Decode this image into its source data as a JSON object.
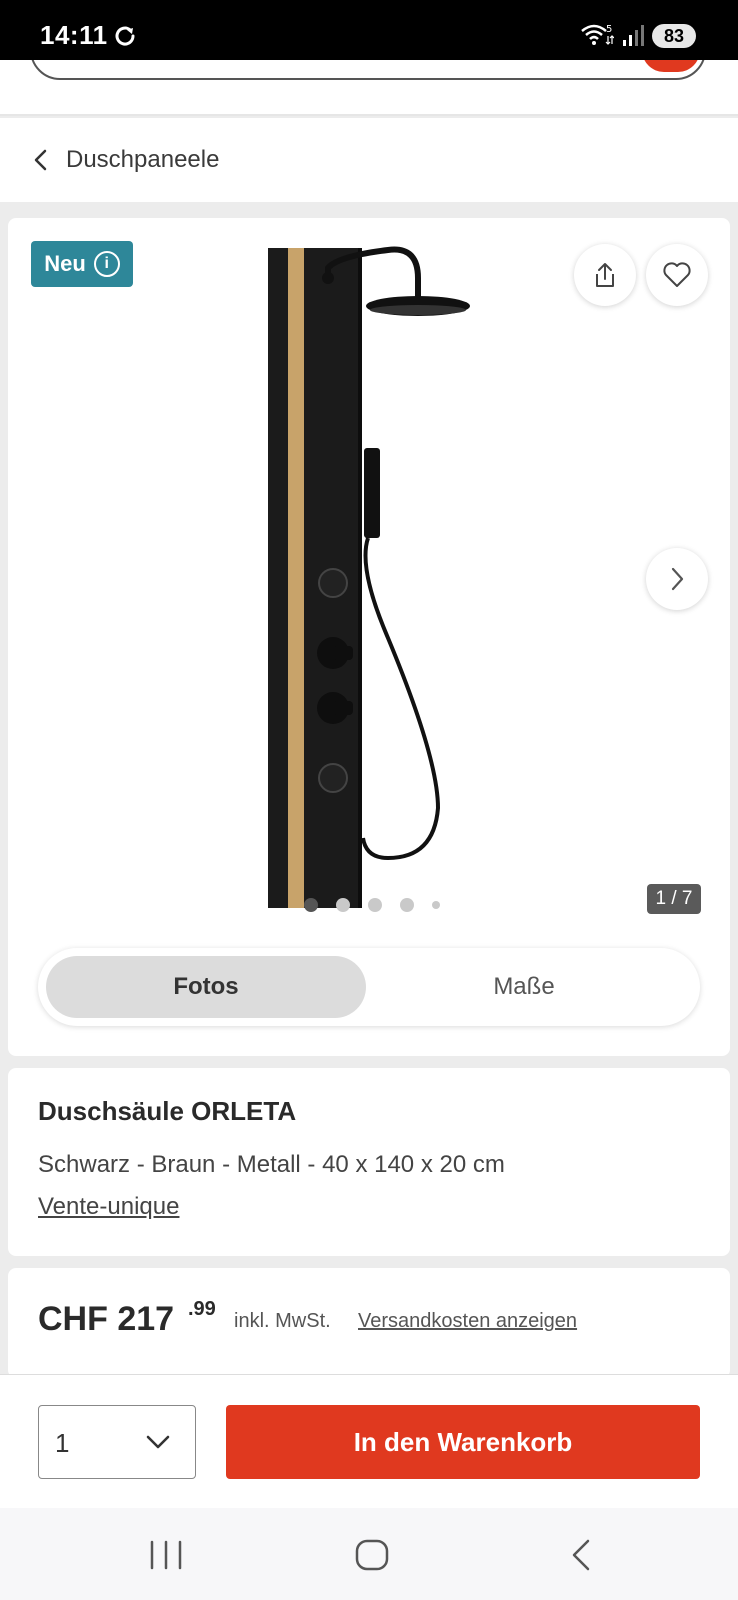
{
  "status_bar": {
    "time": "14:11",
    "battery": "83"
  },
  "breadcrumb": {
    "label": "Duschpaneele"
  },
  "gallery": {
    "badge": "Neu",
    "badge_info": "i",
    "counter": "1 / 7",
    "dots": 5,
    "active_dot": 1,
    "tabs": [
      {
        "label": "Fotos",
        "active": true
      },
      {
        "label": "Maße",
        "active": false
      }
    ]
  },
  "product": {
    "title": "Duschsäule ORLETA",
    "description": "Schwarz - Braun - Metall - 40 x 140 x 20 cm",
    "seller": "Vente-unique"
  },
  "price": {
    "currency_amount": "CHF 217",
    "decimals": ".99",
    "vat_note": "inkl. MwSt.",
    "shipping_link": "Versandkosten anzeigen"
  },
  "cart": {
    "quantity": "1",
    "button_label": "In den Warenkorb"
  },
  "colors": {
    "accent": "#e0391f",
    "badge": "#2e8799"
  },
  "icons": [
    "sync-icon",
    "wifi-icon",
    "signal-icon",
    "back-chevron-icon",
    "share-icon",
    "heart-icon",
    "next-chevron-icon",
    "dropdown-chevron-icon",
    "recents-icon",
    "home-icon",
    "back-nav-icon"
  ]
}
